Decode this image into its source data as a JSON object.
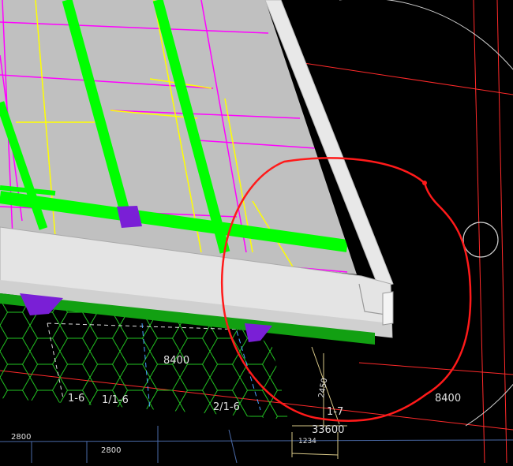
{
  "viewport": {
    "background": "#000000",
    "colors": {
      "slab": "#c0c0c0",
      "slab_edge": "#e8e8e8",
      "beam": "#00ff00",
      "rebar_magenta": "#ff00ff",
      "rebar_yellow": "#ffff00",
      "column": "#7a1fd6",
      "grid_red": "#ff2a2a",
      "markup_red": "#ff1a1a",
      "hex_mesh": "#22c322",
      "dim_line": "#d8c888",
      "label": "#e0e0e0"
    },
    "labels": {
      "dim_8400_center": "8400",
      "dim_8400_right": "8400",
      "axis_1_6": "1-6",
      "axis_1_1_6": "1/1-6",
      "axis_2_1_6": "2/1-6",
      "axis_1_7": "1-7",
      "dim_33600": "33600",
      "dim_2800_left": "2800",
      "dim_2800_mid": "2800",
      "dim_2450": "2450",
      "dim_1234": "1234"
    },
    "icons": {
      "navigation_circle": "circle-outline-icon"
    }
  }
}
